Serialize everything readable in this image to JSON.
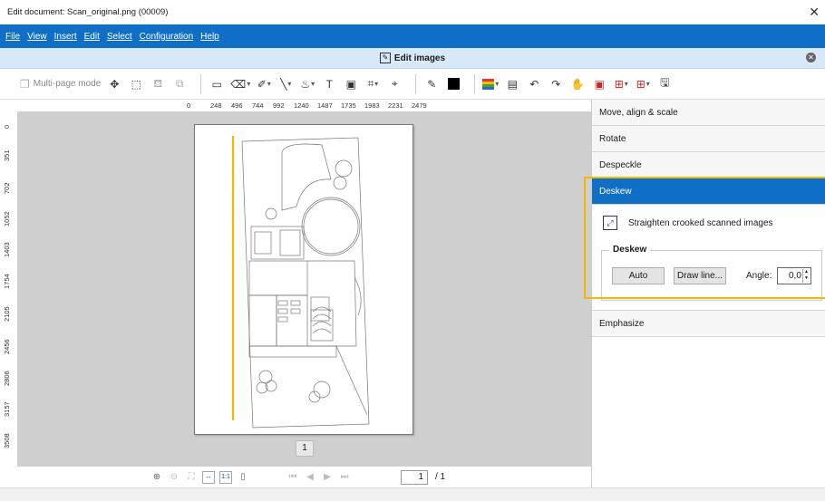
{
  "window": {
    "title": "Edit document: Scan_original.png (00009)",
    "close_glyph": "✕"
  },
  "menu": [
    "File",
    "View",
    "Insert",
    "Edit",
    "Select",
    "Configuration",
    "Help"
  ],
  "panel": {
    "title": "Edit images",
    "close_glyph": "✕"
  },
  "toolbar": {
    "multipage_label": "Multi-page mode",
    "text_tool_glyph": "T"
  },
  "ruler": {
    "top": [
      "0",
      "248",
      "496",
      "744",
      "992",
      "1240",
      "1487",
      "1735",
      "1983",
      "2231",
      "2479"
    ],
    "left": [
      "0",
      "351",
      "702",
      "1052",
      "1403",
      "1754",
      "2105",
      "2456",
      "2806",
      "3157",
      "3508"
    ]
  },
  "canvas": {
    "page_badge": "1"
  },
  "status": {
    "page_value": "1",
    "page_total": "/ 1"
  },
  "sidebar": {
    "sections": [
      "Move, align & scale",
      "Rotate",
      "Despeckle",
      "Deskew",
      "Emphasize"
    ],
    "deskew": {
      "hint": "Straighten crooked scanned images",
      "group_title": "Deskew",
      "auto_label": "Auto",
      "draw_label": "Draw line...",
      "angle_label": "Angle:",
      "angle_value": "0,0"
    }
  },
  "colors": {
    "accent": "#0f6fc6",
    "highlight": "#f5b800",
    "deskew_line": "#f5b800"
  }
}
